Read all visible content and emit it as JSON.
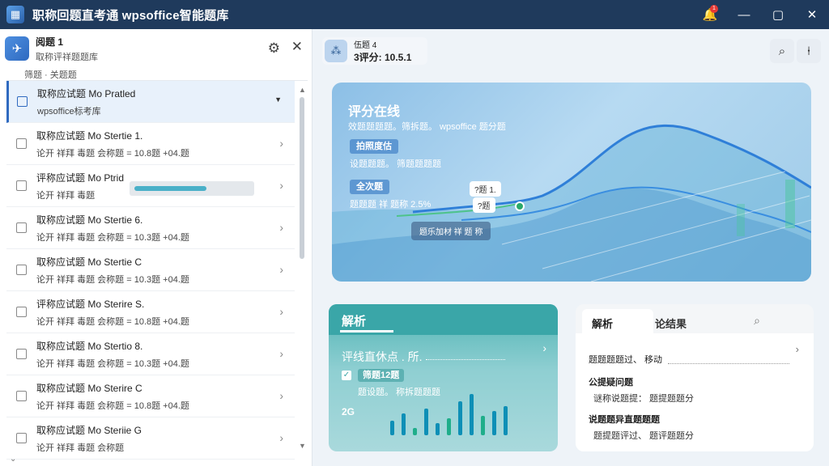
{
  "window": {
    "title": "职称回题直考通 wpsoffice智能题库",
    "logo_glyph": "▦",
    "notification_count": "1"
  },
  "left_panel": {
    "title": "阅题  1",
    "subtitle": "取称评祥题题库",
    "filter_text": "筛题 · 关题题",
    "items": [
      {
        "title": "取称应试题  Mo Pratled",
        "meta": "wpsoffice标考库",
        "active": true
      },
      {
        "title": "取称应试题  Mo Stertie 1.",
        "meta": "论开  祥拜  毒题  会称题  = 10.8题  +04.题"
      },
      {
        "title": "评称应试题  Mo Ptrid",
        "meta": "论开  祥拜  毒题",
        "progress": 0.58
      },
      {
        "title": "取称应试题  Mo Stertie 6.",
        "meta": "论开  祥拜  毒题  会称题  = 10.3题  +04.题"
      },
      {
        "title": "取称应试题  Mo Stertie C",
        "meta": "论开  祥拜  毒题  会称题  = 10.3题  +04.题"
      },
      {
        "title": "评称应试题  Mo Sterire S.",
        "meta": "论开  祥拜  毒题  会称题  = 10.8题  +04.题"
      },
      {
        "title": "取称应试题  Mo Stertio 8.",
        "meta": "论开  祥拜  毒题  会称题  = 10.3题  +04.题"
      },
      {
        "title": "取称应试题  Mo Sterire C",
        "meta": "论开  祥拜  毒题  会称题  = 10.8题  +04.题"
      },
      {
        "title": "取称应试题  Mo Steriie G",
        "meta": "论开  祥拜  毒题  会称题"
      }
    ]
  },
  "right_header": {
    "title": "伍题  4",
    "score": "3评分:  10.5.1"
  },
  "hero": {
    "title": "评分在线",
    "subtitle": "效题题题题。筛拆题。 wpsoffice  题分题",
    "pill1": "拍照度估",
    "line1": "设题题题。 筛题题题题",
    "pill2": "全次题",
    "line2": "题题题  祥  题称 2.5%",
    "tag1": "?题 1.",
    "tag2": "?题",
    "box": "题乐加材  祥  题  称"
  },
  "analysis": {
    "title": "解析",
    "line1": "评线直休点 . 所.",
    "pill": "筛题12题",
    "line2": "题设题。 称拆题题题",
    "num": "2G",
    "bars": [
      0.3,
      0.45,
      0.15,
      0.55,
      0.25,
      0.35,
      0.7,
      0.85,
      0.4,
      0.5,
      0.6
    ]
  },
  "results": {
    "tab_active": "解析",
    "tab2": "论结果",
    "row1": "题题题题过、  移动",
    "h1": "公提疑问题",
    "t1": "谜称说题提：  题提题题分",
    "h2": "说题题异直题题题",
    "t2": "题提题评过、  题评题题分"
  }
}
